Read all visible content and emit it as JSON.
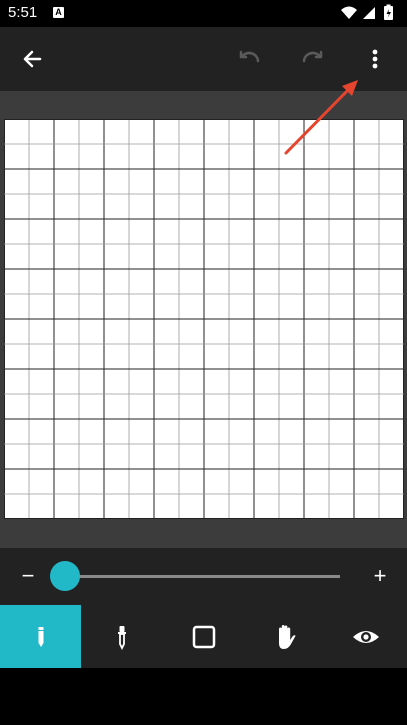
{
  "status_bar": {
    "time": "5:51",
    "notification_badge": "A",
    "icons": [
      "wifi-icon",
      "cellular-icon",
      "battery-icon"
    ]
  },
  "toolbar": {
    "buttons": [
      "back-arrow-icon",
      "undo-icon",
      "redo-icon",
      "more-vert-icon"
    ]
  },
  "canvas": {
    "columns": 16,
    "rows": 16,
    "subdivision": 2
  },
  "zoom": {
    "minus_label": "−",
    "plus_label": "+",
    "value": 0
  },
  "tools": [
    {
      "name": "pencil",
      "icon": "pencil-icon",
      "active": true
    },
    {
      "name": "eyedropper",
      "icon": "eyedropper-icon",
      "active": false
    },
    {
      "name": "rectangle",
      "icon": "square-icon",
      "active": false
    },
    {
      "name": "pan",
      "icon": "hand-icon",
      "active": false
    },
    {
      "name": "preview",
      "icon": "eye-icon",
      "active": false
    }
  ],
  "colors": {
    "accent": "#21b9c8",
    "toolbar_bg": "#222222",
    "canvas_frame": "#3c3c3c",
    "annotation_arrow": "#e5452e"
  }
}
